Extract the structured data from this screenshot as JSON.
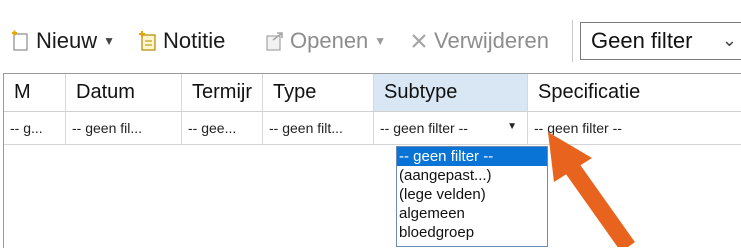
{
  "toolbar": {
    "new_label": "Nieuw",
    "note_label": "Notitie",
    "open_label": "Openen",
    "delete_label": "Verwijderen",
    "filter_value": "Geen filter"
  },
  "grid": {
    "columns": [
      "M",
      "Datum",
      "Termijr",
      "Type",
      "Subtype",
      "Specificatie"
    ],
    "filters": [
      "-- g...",
      "-- geen fil...",
      "-- gee...",
      "-- geen filt...",
      "-- geen filter --",
      "-- geen filter --"
    ]
  },
  "dropdown": {
    "options": [
      "-- geen filter --",
      "(aangepast...)",
      "(lege velden)",
      "algemeen",
      "bloedgroep"
    ]
  },
  "colors": {
    "header_active": "#d9e6f3",
    "selection": "#0a74d6",
    "annotation_arrow": "#e8641e"
  },
  "icons": {
    "new": "new-document-icon",
    "note": "note-icon",
    "open": "open-icon",
    "delete": "delete-x-icon",
    "caret": "caret-down-icon",
    "annotation": "orange-arrow"
  }
}
